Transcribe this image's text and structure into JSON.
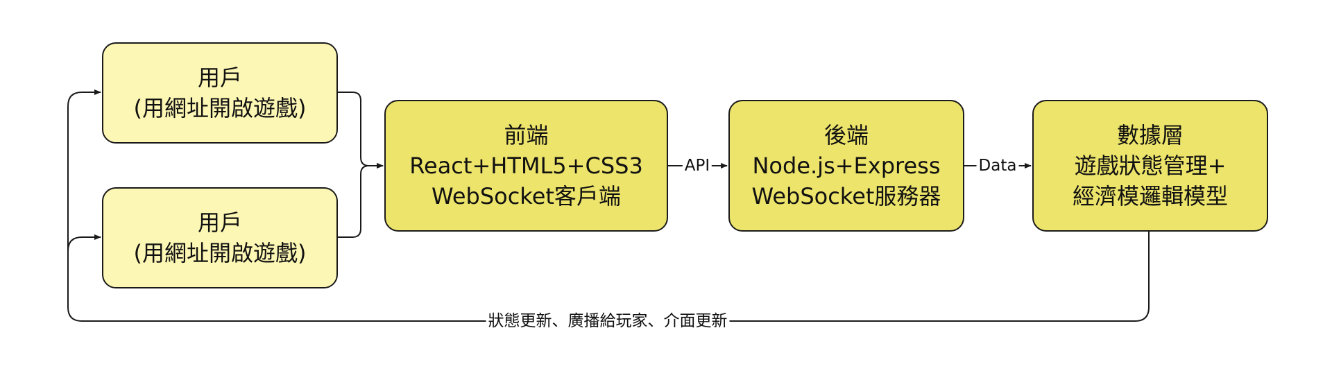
{
  "nodes": {
    "user_top": {
      "line1": "用戶",
      "line2": "(用網址開啟遊戲)"
    },
    "user_bottom": {
      "line1": "用戶",
      "line2": "(用網址開啟遊戲)"
    },
    "frontend": {
      "line1": "前端",
      "line2": "React+HTML5+CSS3",
      "line3": "WebSocket客戶端"
    },
    "backend": {
      "line1": "後端",
      "line2": "Node.js+Express",
      "line3": "WebSocket服務器"
    },
    "data_layer": {
      "line1": "數據層",
      "line2": "遊戲狀態管理+",
      "line3": "經濟模邏輯模型"
    }
  },
  "edges": {
    "api_label": "API",
    "data_label": "Data",
    "feedback_label": "狀態更新、廣播給玩家、介面更新"
  },
  "colors": {
    "user_fill": "#fdf7b5",
    "main_fill": "#ede46b",
    "stroke": "#1a1a1a"
  }
}
